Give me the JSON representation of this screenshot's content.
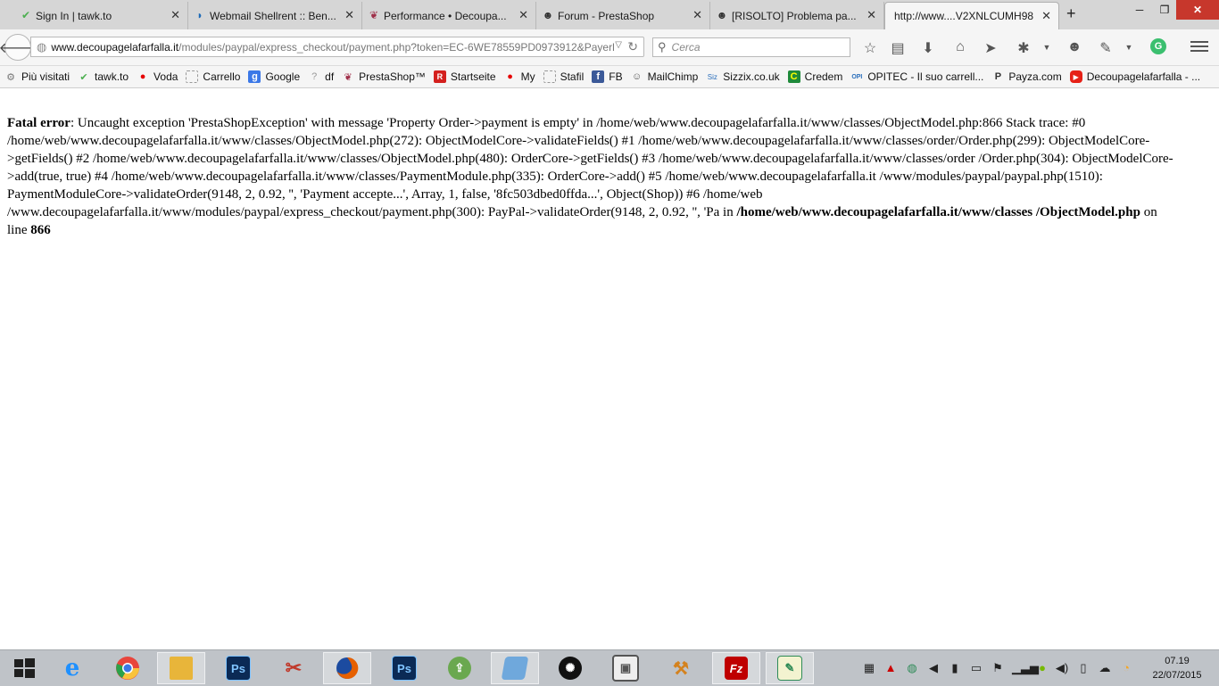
{
  "tabs": [
    {
      "title": "Sign In | tawk.to",
      "icon": "tawk-icon",
      "color": "#4caf50"
    },
    {
      "title": "Webmail Shellrent :: Ben...",
      "icon": "webmail-icon",
      "color": "#1e6bb8"
    },
    {
      "title": "Performance • Decoupa...",
      "icon": "butterfly-icon",
      "color": "#a0304a"
    },
    {
      "title": "Forum - PrestaShop",
      "icon": "prestashop-icon",
      "color": "#333333"
    },
    {
      "title": "[RISOLTO] Problema pa...",
      "icon": "prestashop-icon",
      "color": "#333333"
    },
    {
      "title": "http://www....V2XNLCUMH98",
      "icon": "",
      "color": ""
    }
  ],
  "window": {
    "minimize": "─",
    "maximize": "❐",
    "close": "✕"
  },
  "nav": {
    "url_host": "www.decoupagelafarfalla.it",
    "url_path": "/modules/paypal/express_checkout/payment.php?token=EC-6WE78559PD0973912&Payerl",
    "search_placeholder": "Cerca",
    "accent_green": "#3bbf6f"
  },
  "bookmarks": [
    {
      "label": "Più visitati",
      "icon": "gear-icon",
      "color": "#777777"
    },
    {
      "label": "tawk.to",
      "icon": "tawk-icon",
      "color": "#4caf50"
    },
    {
      "label": "Voda",
      "icon": "vodafone-icon",
      "color": "#e60000"
    },
    {
      "label": "Carrello",
      "icon": "page-icon",
      "color": "#999999"
    },
    {
      "label": "Google",
      "icon": "google-icon",
      "color": "#3b78e7"
    },
    {
      "label": "df",
      "icon": "unknown-icon",
      "color": "#999999"
    },
    {
      "label": "PrestaShop™",
      "icon": "butterfly-icon",
      "color": "#a0304a"
    },
    {
      "label": "Startseite",
      "icon": "startseite-icon",
      "color": "#d4201e"
    },
    {
      "label": "My",
      "icon": "vodafone-icon",
      "color": "#e60000"
    },
    {
      "label": "Stafil",
      "icon": "page-icon",
      "color": "#999999"
    },
    {
      "label": "FB",
      "icon": "facebook-icon",
      "color": "#3b5998"
    },
    {
      "label": "MailChimp",
      "icon": "mailchimp-icon",
      "color": "#555555"
    },
    {
      "label": "Sizzix.co.uk",
      "icon": "sizzix-icon",
      "color": "#2a6ebb"
    },
    {
      "label": "Credem",
      "icon": "credem-icon",
      "color": "#1f8a3a"
    },
    {
      "label": "OPITEC - Il suo carrell...",
      "icon": "opitec-icon",
      "color": "#2a6ebb"
    },
    {
      "label": "Payza.com",
      "icon": "payza-icon",
      "color": "#333333"
    },
    {
      "label": "Decoupagelafarfalla - ...",
      "icon": "youtube-icon",
      "color": "#e62117"
    }
  ],
  "error": {
    "label": "Fatal error",
    "message": ": Uncaught exception 'PrestaShopException' with message 'Property Order->payment is empty' in /home/web/www.decoupagelafarfalla.it/www/classes/ObjectModel.php:866 Stack trace: #0 /home/web/www.decoupagelafarfalla.it/www/classes/ObjectModel.php(272): ObjectModelCore->validateFields() #1 /home/web/www.decoupagelafarfalla.it/www/classes/order/Order.php(299): ObjectModelCore->getFields() #2 /home/web/www.decoupagelafarfalla.it/www/classes/ObjectModel.php(480): OrderCore->getFields() #3 /home/web/www.decoupagelafarfalla.it/www/classes/order /Order.php(304): ObjectModelCore->add(true, true) #4 /home/web/www.decoupagelafarfalla.it/www/classes/PaymentModule.php(335): OrderCore->add() #5 /home/web/www.decoupagelafarfalla.it /www/modules/paypal/paypal.php(1510): PaymentModuleCore->validateOrder(9148, 2, 0.92, '', 'Payment accepte...', Array, 1, false, '8fc503dbed0ffda...', Object(Shop)) #6 /home/web /www.decoupagelafarfalla.it/www/modules/paypal/express_checkout/payment.php(300): PayPal->validateOrder(9148, 2, 0.92, '', 'Pa in ",
    "file": "/home/web/www.decoupagelafarfalla.it/www/classes /ObjectModel.php",
    "on_line": " on line ",
    "line": "866"
  },
  "taskbar": {
    "apps": [
      {
        "name": "windows-start-icon",
        "label": "",
        "color": "#1f1f1f"
      },
      {
        "name": "internet-explorer-icon",
        "label": "e",
        "color": "#1e90ff"
      },
      {
        "name": "chrome-icon",
        "label": "",
        "color": "#e8453c"
      },
      {
        "name": "file-explorer-icon",
        "label": "",
        "color": "#e8b53a"
      },
      {
        "name": "photoshop-icon",
        "label": "Ps",
        "color": "#0b2a55"
      },
      {
        "name": "paint-icon",
        "label": "",
        "color": "#c0392b"
      },
      {
        "name": "firefox-icon",
        "label": "",
        "color": "#e66000"
      },
      {
        "name": "photoshop-icon",
        "label": "Ps",
        "color": "#0b2a55"
      },
      {
        "name": "upload-icon",
        "label": "",
        "color": "#6aa84f"
      },
      {
        "name": "book-icon",
        "label": "",
        "color": "#6fa8dc"
      },
      {
        "name": "spiral-icon",
        "label": "",
        "color": "#111111"
      },
      {
        "name": "media-icon",
        "label": "",
        "color": "#555555"
      },
      {
        "name": "tools-icon",
        "label": "",
        "color": "#d4821e"
      },
      {
        "name": "filezilla-icon",
        "label": "Fz",
        "color": "#bf0000"
      },
      {
        "name": "notepad-icon",
        "label": "",
        "color": "#2e8b57"
      }
    ],
    "time": "07.19",
    "date": "22/07/2015"
  }
}
